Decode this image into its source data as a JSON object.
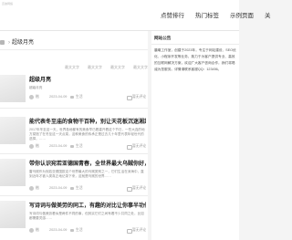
{
  "header": {
    "site_name": "迈迪网络",
    "nav": [
      {
        "label": "点赞排行"
      },
      {
        "label": "热门标签"
      },
      {
        "label": "示例页面"
      },
      {
        "label": "关"
      }
    ]
  },
  "breadcrumb": {
    "current": "超级月亮"
  },
  "tags": [
    "最文文字",
    "最文文字",
    "最文文字",
    "最文文字"
  ],
  "articles": [
    {
      "title": "超级月亮",
      "excerpt": "超级月亮",
      "author": "楷",
      "date": "2023-04-09",
      "category": "生活",
      "comments": "暂无评论"
    },
    {
      "title": "能代表冬至庙的食物干百种，别让天花板沉迷湘菜的设立",
      "excerpt": "2017年冬至这一天，世界各地都有的美食早已着重开着这个节日，一些大连的地方菜馆了在冬至这一天点菜，这种美食的传承正是过去几十年里代表年轻世代的选择，……",
      "author": "楷",
      "date": "2023-04-09",
      "category": "生活",
      "comments": "暂无评论"
    },
    {
      "title": "带你认识宛若亚德国青春，全世界最大乌贼你好，世界拔乌的天空",
      "excerpt": "雷乌贼作为宛若亚德国拔这个世界最大的乌贼类别之一，它们生活在深海中，直到近年才被人类真正地记录下来，这就是乌贼的世界……",
      "author": "楷",
      "date": "2023-04-09",
      "category": "生活",
      "comments": "暂无评论"
    },
    {
      "title": "写诗词与做美劳的同工，有趣的对比让你事半功倍",
      "excerpt": "写诗词与做美劳看似是两件不同的事，但其实它们之间有着不少共同之处，比如都需要灵感……",
      "author": "楷",
      "date": "2023-04-09",
      "category": "生活",
      "comments": "暂无评论"
    }
  ],
  "sidebar": {
    "title": "网站公告",
    "notice": "晨曦工作室，创建于2023年，专注于网站建设、SEO优化、小程序开发等业务，致力于为客户提供专业、高效的互联网解决方案，欢迎广大客户咨询合作，我们将竭诚为您服务。详情请联系客服QQ：123456。"
  }
}
